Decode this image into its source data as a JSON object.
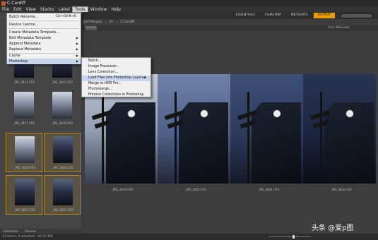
{
  "window": {
    "title": "C:Cardiff"
  },
  "menubar": {
    "items": [
      "File",
      "Edit",
      "View",
      "Stacks",
      "Label",
      "Tools",
      "Window",
      "Help"
    ],
    "active_index": 5
  },
  "toolbar": {
    "workspaces": [
      "ESSENTIALS",
      "FILMSTRIP",
      "METADATA",
      "OUTPUT"
    ],
    "active_workspace": "OUTPUT"
  },
  "path": {
    "crumbs": [
      "Jeff Morgan",
      "D:\\",
      "C:Cardiff"
    ]
  },
  "sort_label": "Sort Manually",
  "content_header": "Content",
  "tools_menu": {
    "items": [
      {
        "label": "Batch Rename...",
        "shortcut": "Ctrl+Shift+R"
      },
      {
        "label": "Device Central..."
      },
      {
        "label": "Create Metadata Template..."
      },
      {
        "label": "Edit Metadata Template",
        "submenu": true
      },
      {
        "label": "Append Metadata",
        "submenu": true
      },
      {
        "label": "Replace Metadata",
        "submenu": true
      },
      {
        "label": "Cache",
        "submenu": true
      },
      {
        "label": "Photoshop",
        "submenu": true
      }
    ]
  },
  "photoshop_submenu": {
    "items": [
      "Batch...",
      "Image Processor...",
      "Lens Correction...",
      "Load Files into Photoshop Layers...",
      "Merge to HDR Pro...",
      "Photomerge...",
      "Process Collections in Photoshop"
    ],
    "highlighted_index": 3
  },
  "thumbnails": [
    {
      "caption": "_MG_3814.CR2",
      "selected": false,
      "dark": true
    },
    {
      "caption": "_MG_3816.CR2",
      "selected": false,
      "dark": true
    },
    {
      "caption": "_MG_3817.CR2",
      "selected": false,
      "dark": false
    },
    {
      "caption": "_MG_3818.CR2",
      "selected": false,
      "dark": false
    },
    {
      "caption": "_MG_3819.CR2",
      "selected": true,
      "dark": false
    },
    {
      "caption": "_MG_3820.CR2",
      "selected": true,
      "dark": true
    },
    {
      "caption": "_MG_3821.CR2",
      "selected": true,
      "dark": true
    },
    {
      "caption": "_MG_3822.CR2",
      "selected": true,
      "dark": true
    }
  ],
  "preview_photos": [
    {
      "caption": "_MG_3819.CR2"
    },
    {
      "caption": "_MG_3820.CR2"
    },
    {
      "caption": "_MG_3821.CR2"
    },
    {
      "caption": "_MG_3822.CR2"
    }
  ],
  "left_tabs": [
    "Collections",
    "Preview"
  ],
  "status": {
    "text": "13 items, 4 selected - 92.27 MB"
  },
  "watermark": "头条 @爱p图"
}
